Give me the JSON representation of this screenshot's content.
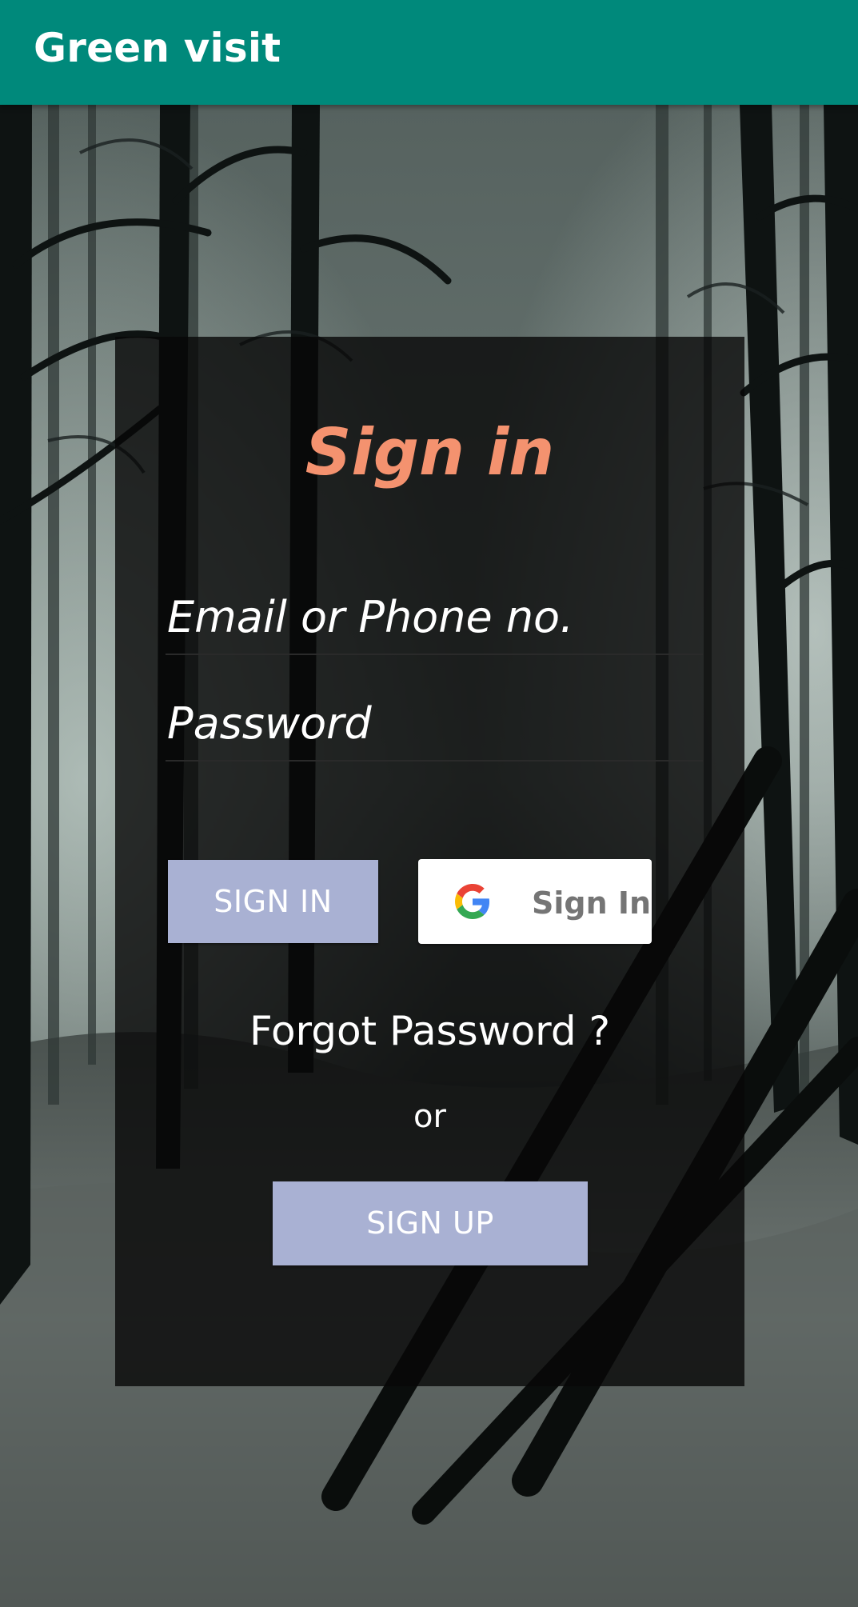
{
  "app_bar": {
    "title": "Green visit",
    "color": "#00897b"
  },
  "background": {
    "description_icon": "forest-background-image"
  },
  "card": {
    "title": "Sign in",
    "title_color": "#f4926f",
    "email": {
      "placeholder": "Email or Phone no.",
      "value": ""
    },
    "password": {
      "placeholder": "Password",
      "value": ""
    },
    "sign_in_label": "SIGN IN",
    "google": {
      "label": "Sign In",
      "icon": "google-g-icon"
    },
    "forgot_label": "Forgot Password ?",
    "or_label": "or",
    "sign_up_label": "SIGN UP",
    "button_color": "#a9b1d3"
  }
}
